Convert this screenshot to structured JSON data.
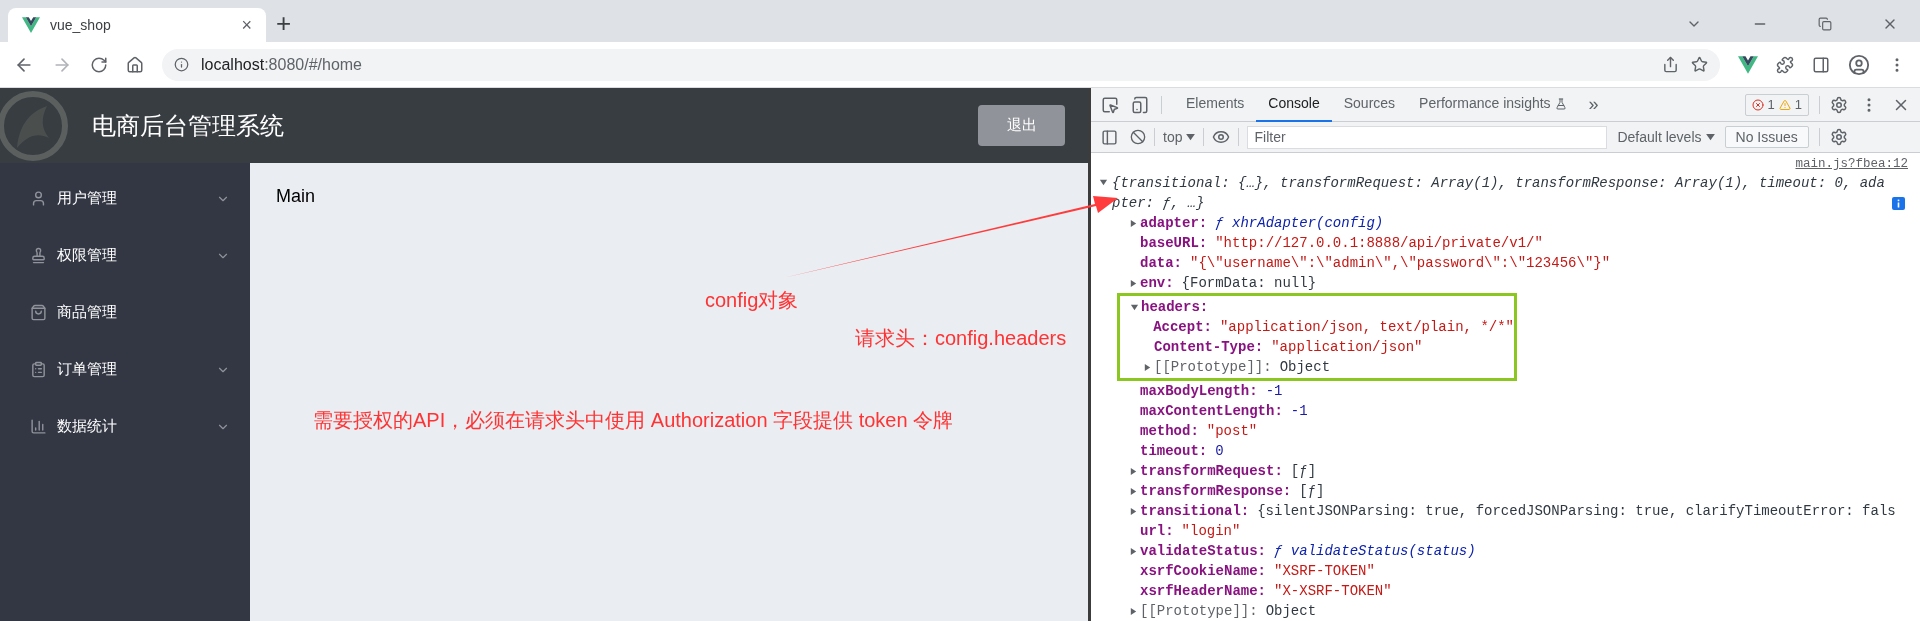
{
  "browser": {
    "tab": {
      "title": "vue_shop",
      "close": "×"
    },
    "new_tab": "+",
    "address": {
      "host": "localhost",
      "path": ":8080/#/home"
    }
  },
  "app": {
    "title": "电商后台管理系统",
    "logout": "退出",
    "sidebar": [
      {
        "label": "用户管理",
        "has_submenu": true
      },
      {
        "label": "权限管理",
        "has_submenu": true
      },
      {
        "label": "商品管理",
        "has_submenu": false
      },
      {
        "label": "订单管理",
        "has_submenu": true
      },
      {
        "label": "数据统计",
        "has_submenu": true
      }
    ],
    "main_text": "Main"
  },
  "devtools": {
    "tabs": [
      {
        "label": "Elements",
        "selected": false
      },
      {
        "label": "Console",
        "selected": true
      },
      {
        "label": "Sources",
        "selected": false
      },
      {
        "label": "Performance insights",
        "selected": false
      }
    ],
    "more": "»",
    "errors": "1",
    "warnings": "1",
    "context": "top",
    "filter": {
      "placeholder": "Filter"
    },
    "levels": "Default levels",
    "issues": "No Issues",
    "console": {
      "source": "main.js?fbea:12",
      "summary": "{transitional: {…}, transformRequest: Array(1), transformResponse: Array(1), timeout: 0, adapter: ƒ, …}",
      "expanded": true,
      "props": [
        {
          "key": "adapter:",
          "value": "ƒ xhrAdapter(config)",
          "kind": "function",
          "expandable": true,
          "expanded": false
        },
        {
          "key": "baseURL:",
          "value": "\"http://127.0.0.1:8888/api/private/v1/\"",
          "kind": "string",
          "expandable": false
        },
        {
          "key": "data:",
          "value": "\"{\\\"username\\\":\\\"admin\\\",\\\"password\\\":\\\"123456\\\"}\"",
          "kind": "string",
          "expandable": false
        },
        {
          "key": "env:",
          "value": "{FormData: null}",
          "kind": "object",
          "expandable": true,
          "expanded": false
        },
        {
          "key": "headers:",
          "expandable": true,
          "expanded": true,
          "highlighted": true,
          "children": [
            {
              "key": "Accept:",
              "value": "\"application/json, text/plain, */*\"",
              "kind": "string",
              "expandable": false
            },
            {
              "key": "Content-Type:",
              "value": "\"application/json\"",
              "kind": "string",
              "expandable": false
            },
            {
              "key": "[[Prototype]]:",
              "value": "Object",
              "kind": "object",
              "expandable": true,
              "expanded": false,
              "internal": true
            }
          ]
        },
        {
          "key": "maxBodyLength:",
          "value": "-1",
          "kind": "number",
          "expandable": false
        },
        {
          "key": "maxContentLength:",
          "value": "-1",
          "kind": "number",
          "expandable": false
        },
        {
          "key": "method:",
          "value": "\"post\"",
          "kind": "string",
          "expandable": false
        },
        {
          "key": "timeout:",
          "value": "0",
          "kind": "number",
          "expandable": false
        },
        {
          "key": "transformRequest:",
          "value": "[ƒ]",
          "kind": "object",
          "expandable": true,
          "expanded": false
        },
        {
          "key": "transformResponse:",
          "value": "[ƒ]",
          "kind": "object",
          "expandable": true,
          "expanded": false
        },
        {
          "key": "transitional:",
          "value": "{silentJSONParsing: true, forcedJSONParsing: true, clarifyTimeoutError: fals",
          "kind": "object",
          "expandable": true,
          "expanded": false
        },
        {
          "key": "url:",
          "value": "\"login\"",
          "kind": "string",
          "expandable": false
        },
        {
          "key": "validateStatus:",
          "value": "ƒ validateStatus(status)",
          "kind": "function",
          "expandable": true,
          "expanded": false
        },
        {
          "key": "xsrfCookieName:",
          "value": "\"XSRF-TOKEN\"",
          "kind": "string",
          "expandable": false
        },
        {
          "key": "xsrfHeaderName:",
          "value": "\"X-XSRF-TOKEN\"",
          "kind": "string",
          "expandable": false
        },
        {
          "key": "[[Prototype]]:",
          "value": "Object",
          "kind": "object",
          "expandable": true,
          "expanded": false,
          "internal": true
        }
      ]
    }
  },
  "annotations": [
    {
      "kind": "object_label",
      "text": "config对象"
    },
    {
      "kind": "headers_label",
      "text": "请求头：config.headers"
    },
    {
      "kind": "note",
      "text": "需要授权的API，必须在请求头中使用 Authorization 字段提供 token 令牌"
    }
  ]
}
